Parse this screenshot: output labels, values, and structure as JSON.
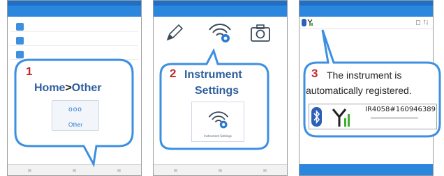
{
  "panels": {
    "home": {
      "nav_title": "Home",
      "other_tile_label": "Other"
    },
    "menu": {
      "nav_title": "Other",
      "instrument_settings_label": "Instrument Settings"
    },
    "register": {
      "serial": "IR4058#160946389"
    }
  },
  "callouts": {
    "step1": {
      "number": "1",
      "home": "Home",
      "separator": ">",
      "other": "Other",
      "tile_glyph": "ooo",
      "tile_label": "Other"
    },
    "step2": {
      "number": "2",
      "title_line1": "Instrument",
      "title_line2": "Settings"
    },
    "step3": {
      "number": "3",
      "line1": "The instrument is",
      "line2": "automatically registered.",
      "serial": "IR4058#160946389"
    }
  },
  "colors": {
    "accent_blue": "#2b86dd",
    "title_blue": "#2f5e9e",
    "step_red": "#c0282f",
    "callout_border": "#3d8fe0",
    "signal_green": "#3dae2b"
  },
  "icons": [
    "pencil-icon",
    "wireless-gear-icon",
    "camera-icon",
    "bluetooth-icon",
    "signal-antenna-icon",
    "trash-icon",
    "sort-icon"
  ]
}
